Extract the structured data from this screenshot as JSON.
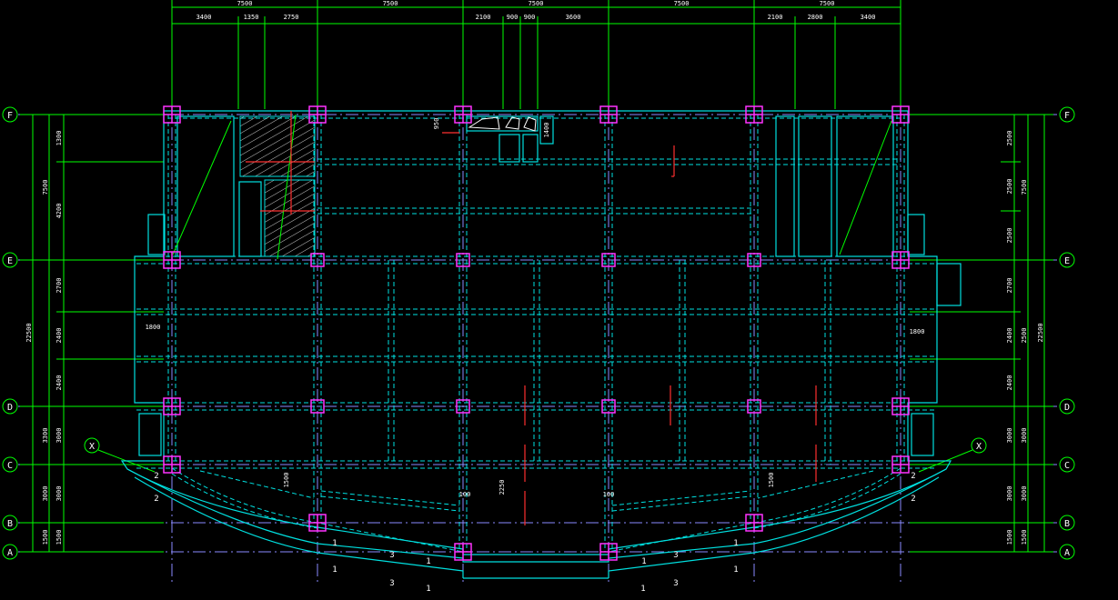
{
  "colors": {
    "background": "#000000",
    "dimension": "#00ff00",
    "axis": "#8a8aff",
    "beam": "#00e0e0",
    "column": "#ff33ff",
    "rebar": "#ff3030",
    "text": "#ffffff",
    "hatch": "#ffffff"
  },
  "grid": {
    "top_dims": [
      "7500",
      "7500",
      "7500",
      "7500",
      "7500"
    ],
    "top_sub_dims": [
      "3400",
      "1350",
      "2750",
      "2100",
      "900",
      "900",
      "3600",
      "2100",
      "2800",
      "3400"
    ],
    "axis_labels": [
      "F",
      "E",
      "D",
      "C",
      "B",
      "A"
    ],
    "x_label": "X",
    "left_dims": [
      "7500",
      "3300",
      "3000",
      "1500"
    ],
    "left_sub_dims": [
      "1300",
      "4200",
      "2700",
      "2400",
      "2400",
      "3000",
      "3000",
      "1500"
    ],
    "left_total": "22500",
    "right_dims": [
      "7500",
      "3000",
      "3000",
      "1500"
    ],
    "right_sub_dims": [
      "2500",
      "2500",
      "2500",
      "2700",
      "2400",
      "2400",
      "3000",
      "3000",
      "1500"
    ],
    "right_total": "22500",
    "right_mid_dim": "2500"
  },
  "annotations": {
    "stair_left": "1800",
    "stair_right": "1800",
    "dim_1500_left": "1500",
    "dim_1500_right": "1500",
    "dim_2250": "2250",
    "dim_100_a": "100",
    "dim_100_b": "100",
    "dim_950": "950",
    "dim_1400": "1400",
    "beam_marks": [
      "1",
      "3",
      "1",
      "1",
      "3",
      "1",
      "1",
      "1",
      "3",
      "1",
      "1",
      "3",
      "2",
      "2",
      "2",
      "2"
    ]
  }
}
